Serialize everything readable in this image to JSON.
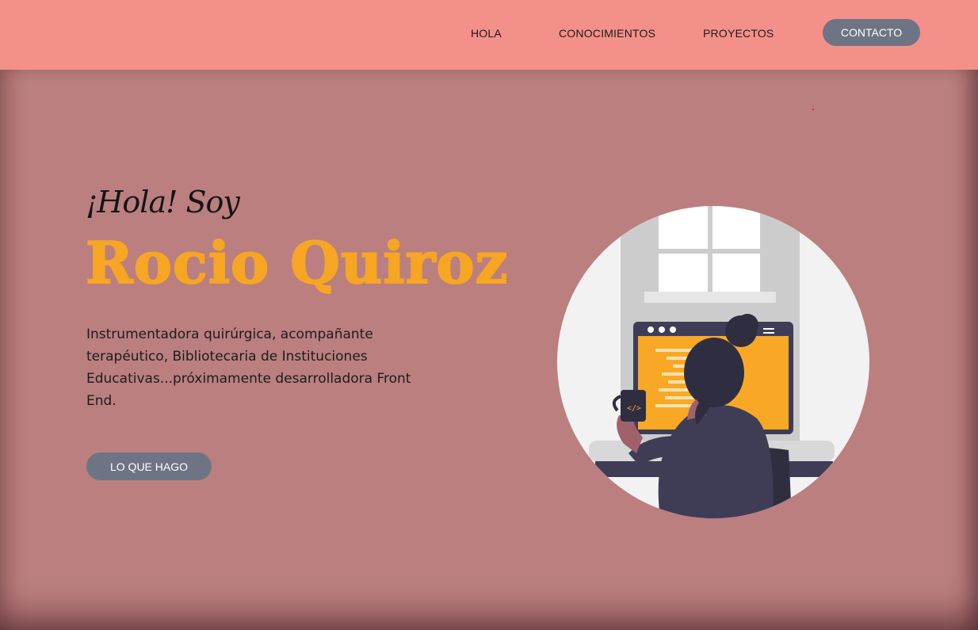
{
  "nav": {
    "links": [
      "HOLA",
      "CONOCIMIENTOS",
      "PROYECTOS"
    ],
    "contact_label": "CONTACTO"
  },
  "hero": {
    "greeting": "¡Hola! Soy",
    "name": "Rocio Quiroz",
    "description": "Instrumentadora quirúrgica, acompañante terapéutico, Bibliotecaria de Instituciones Educativas...próximamente desarrolladora Front End.",
    "cta_label": "LO QUE HAGO",
    "illustration_icon": "developer-at-computer-illustration"
  },
  "colors": {
    "navbar": "#f4908a",
    "hero_background": "#bb7f7f",
    "name_accent": "#f6a623",
    "button": "#6e7483"
  }
}
